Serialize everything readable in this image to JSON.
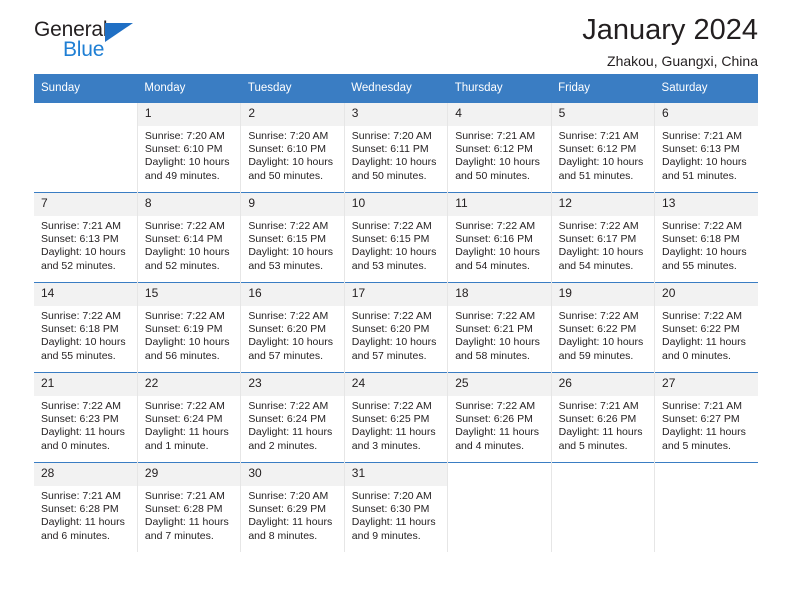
{
  "brand": {
    "name_dark": "General",
    "name_blue": "Blue",
    "accent_color": "#1f7fd4",
    "triangle_color": "#1f6fc4"
  },
  "header": {
    "title": "January 2024",
    "location": "Zhakou, Guangxi, China"
  },
  "calendar": {
    "header_bg": "#3a7dc3",
    "daynum_bg": "#f2f2f2",
    "weekdays": [
      "Sunday",
      "Monday",
      "Tuesday",
      "Wednesday",
      "Thursday",
      "Friday",
      "Saturday"
    ],
    "weeks": [
      [
        {
          "day": "",
          "lines": []
        },
        {
          "day": "1",
          "lines": [
            "Sunrise: 7:20 AM",
            "Sunset: 6:10 PM",
            "Daylight: 10 hours",
            "and 49 minutes."
          ]
        },
        {
          "day": "2",
          "lines": [
            "Sunrise: 7:20 AM",
            "Sunset: 6:10 PM",
            "Daylight: 10 hours",
            "and 50 minutes."
          ]
        },
        {
          "day": "3",
          "lines": [
            "Sunrise: 7:20 AM",
            "Sunset: 6:11 PM",
            "Daylight: 10 hours",
            "and 50 minutes."
          ]
        },
        {
          "day": "4",
          "lines": [
            "Sunrise: 7:21 AM",
            "Sunset: 6:12 PM",
            "Daylight: 10 hours",
            "and 50 minutes."
          ]
        },
        {
          "day": "5",
          "lines": [
            "Sunrise: 7:21 AM",
            "Sunset: 6:12 PM",
            "Daylight: 10 hours",
            "and 51 minutes."
          ]
        },
        {
          "day": "6",
          "lines": [
            "Sunrise: 7:21 AM",
            "Sunset: 6:13 PM",
            "Daylight: 10 hours",
            "and 51 minutes."
          ]
        }
      ],
      [
        {
          "day": "7",
          "lines": [
            "Sunrise: 7:21 AM",
            "Sunset: 6:13 PM",
            "Daylight: 10 hours",
            "and 52 minutes."
          ]
        },
        {
          "day": "8",
          "lines": [
            "Sunrise: 7:22 AM",
            "Sunset: 6:14 PM",
            "Daylight: 10 hours",
            "and 52 minutes."
          ]
        },
        {
          "day": "9",
          "lines": [
            "Sunrise: 7:22 AM",
            "Sunset: 6:15 PM",
            "Daylight: 10 hours",
            "and 53 minutes."
          ]
        },
        {
          "day": "10",
          "lines": [
            "Sunrise: 7:22 AM",
            "Sunset: 6:15 PM",
            "Daylight: 10 hours",
            "and 53 minutes."
          ]
        },
        {
          "day": "11",
          "lines": [
            "Sunrise: 7:22 AM",
            "Sunset: 6:16 PM",
            "Daylight: 10 hours",
            "and 54 minutes."
          ]
        },
        {
          "day": "12",
          "lines": [
            "Sunrise: 7:22 AM",
            "Sunset: 6:17 PM",
            "Daylight: 10 hours",
            "and 54 minutes."
          ]
        },
        {
          "day": "13",
          "lines": [
            "Sunrise: 7:22 AM",
            "Sunset: 6:18 PM",
            "Daylight: 10 hours",
            "and 55 minutes."
          ]
        }
      ],
      [
        {
          "day": "14",
          "lines": [
            "Sunrise: 7:22 AM",
            "Sunset: 6:18 PM",
            "Daylight: 10 hours",
            "and 55 minutes."
          ]
        },
        {
          "day": "15",
          "lines": [
            "Sunrise: 7:22 AM",
            "Sunset: 6:19 PM",
            "Daylight: 10 hours",
            "and 56 minutes."
          ]
        },
        {
          "day": "16",
          "lines": [
            "Sunrise: 7:22 AM",
            "Sunset: 6:20 PM",
            "Daylight: 10 hours",
            "and 57 minutes."
          ]
        },
        {
          "day": "17",
          "lines": [
            "Sunrise: 7:22 AM",
            "Sunset: 6:20 PM",
            "Daylight: 10 hours",
            "and 57 minutes."
          ]
        },
        {
          "day": "18",
          "lines": [
            "Sunrise: 7:22 AM",
            "Sunset: 6:21 PM",
            "Daylight: 10 hours",
            "and 58 minutes."
          ]
        },
        {
          "day": "19",
          "lines": [
            "Sunrise: 7:22 AM",
            "Sunset: 6:22 PM",
            "Daylight: 10 hours",
            "and 59 minutes."
          ]
        },
        {
          "day": "20",
          "lines": [
            "Sunrise: 7:22 AM",
            "Sunset: 6:22 PM",
            "Daylight: 11 hours",
            "and 0 minutes."
          ]
        }
      ],
      [
        {
          "day": "21",
          "lines": [
            "Sunrise: 7:22 AM",
            "Sunset: 6:23 PM",
            "Daylight: 11 hours",
            "and 0 minutes."
          ]
        },
        {
          "day": "22",
          "lines": [
            "Sunrise: 7:22 AM",
            "Sunset: 6:24 PM",
            "Daylight: 11 hours",
            "and 1 minute."
          ]
        },
        {
          "day": "23",
          "lines": [
            "Sunrise: 7:22 AM",
            "Sunset: 6:24 PM",
            "Daylight: 11 hours",
            "and 2 minutes."
          ]
        },
        {
          "day": "24",
          "lines": [
            "Sunrise: 7:22 AM",
            "Sunset: 6:25 PM",
            "Daylight: 11 hours",
            "and 3 minutes."
          ]
        },
        {
          "day": "25",
          "lines": [
            "Sunrise: 7:22 AM",
            "Sunset: 6:26 PM",
            "Daylight: 11 hours",
            "and 4 minutes."
          ]
        },
        {
          "day": "26",
          "lines": [
            "Sunrise: 7:21 AM",
            "Sunset: 6:26 PM",
            "Daylight: 11 hours",
            "and 5 minutes."
          ]
        },
        {
          "day": "27",
          "lines": [
            "Sunrise: 7:21 AM",
            "Sunset: 6:27 PM",
            "Daylight: 11 hours",
            "and 5 minutes."
          ]
        }
      ],
      [
        {
          "day": "28",
          "lines": [
            "Sunrise: 7:21 AM",
            "Sunset: 6:28 PM",
            "Daylight: 11 hours",
            "and 6 minutes."
          ]
        },
        {
          "day": "29",
          "lines": [
            "Sunrise: 7:21 AM",
            "Sunset: 6:28 PM",
            "Daylight: 11 hours",
            "and 7 minutes."
          ]
        },
        {
          "day": "30",
          "lines": [
            "Sunrise: 7:20 AM",
            "Sunset: 6:29 PM",
            "Daylight: 11 hours",
            "and 8 minutes."
          ]
        },
        {
          "day": "31",
          "lines": [
            "Sunrise: 7:20 AM",
            "Sunset: 6:30 PM",
            "Daylight: 11 hours",
            "and 9 minutes."
          ]
        },
        {
          "day": "",
          "lines": []
        },
        {
          "day": "",
          "lines": []
        },
        {
          "day": "",
          "lines": []
        }
      ]
    ]
  }
}
